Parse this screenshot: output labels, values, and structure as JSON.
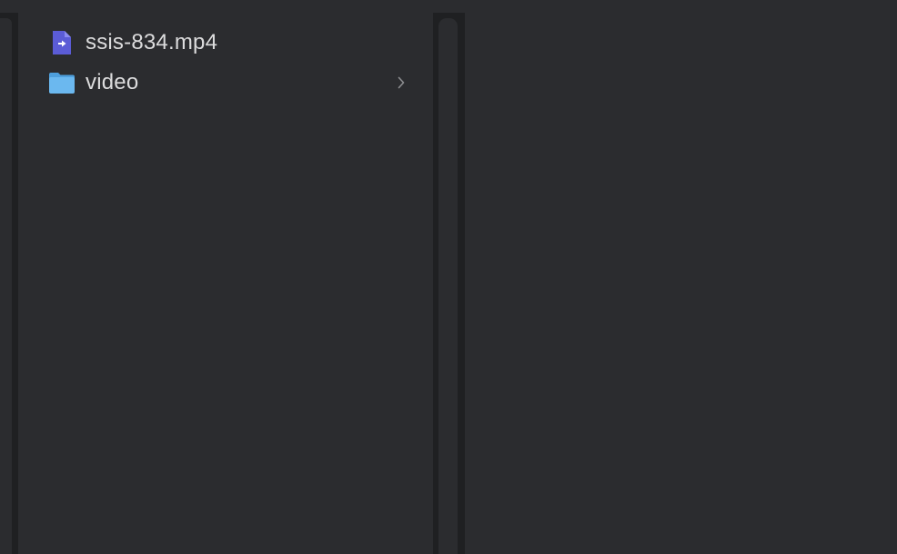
{
  "browser": {
    "items": [
      {
        "name": "ssis-834.mp4",
        "type": "file",
        "icon": "video-file-icon"
      },
      {
        "name": "video",
        "type": "folder",
        "icon": "folder-icon",
        "has_children": true
      }
    ]
  },
  "colors": {
    "background": "#2b2c2f",
    "gutter": "#1f2022",
    "text": "#dcdcdd",
    "file_icon": "#5b5cd6",
    "folder_icon": "#6bb8ef",
    "chevron": "#8d8e91"
  }
}
